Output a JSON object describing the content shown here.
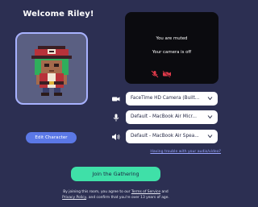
{
  "header": {
    "welcome": "Welcome Riley!"
  },
  "avatar": {
    "edit_label": "Edit Character"
  },
  "video": {
    "muted_text": "You are muted",
    "camera_text": "Your camera is off",
    "mic_off_icon": "mic-off-icon",
    "camera_off_icon": "camera-off-icon"
  },
  "devices": {
    "camera": {
      "icon": "video-camera-icon",
      "value": "FaceTime HD Camera (Built..."
    },
    "microphone": {
      "icon": "microphone-icon",
      "value": "Default - MacBook Air Micr..."
    },
    "speaker": {
      "icon": "speaker-icon",
      "value": "Default - MacBook Air Spea..."
    }
  },
  "help": {
    "trouble_link": "Having trouble with your audio/video?"
  },
  "join": {
    "label": "Join the Gathering"
  },
  "terms": {
    "part1": "By joining this room, you agree to our ",
    "tos_link": "Terms of Service",
    "part2": " and",
    "privacy_link": "Privacy Policy",
    "part3": ", and confirm that you're over 13 years of age."
  },
  "colors": {
    "background": "#2c2f52",
    "accent_blue": "#5b78e6",
    "join_green": "#3fe0a8",
    "muted_red": "#e03a4a"
  }
}
